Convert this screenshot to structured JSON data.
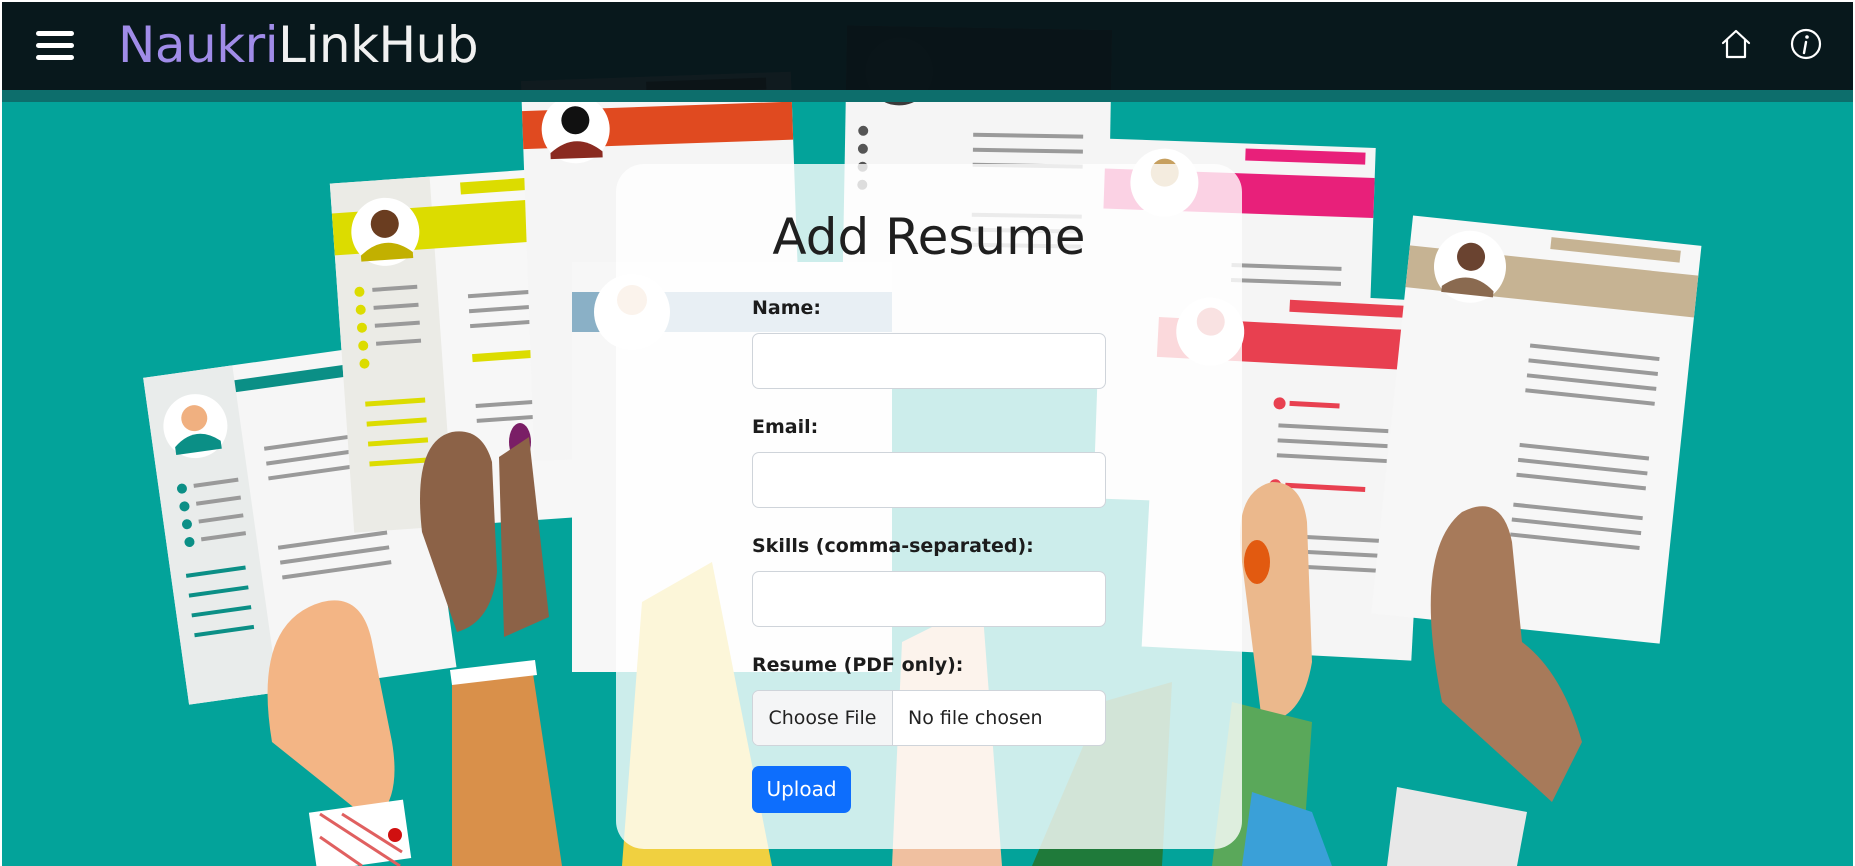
{
  "navbar": {
    "brand_part1": "Naukri",
    "brand_part2": "LinkHub",
    "menu_icon": "hamburger-menu-icon",
    "home_icon": "home-icon",
    "info_icon": "info-icon"
  },
  "form": {
    "title": "Add Resume",
    "name_label": "Name:",
    "email_label": "Email:",
    "skills_label": "Skills (comma-separated):",
    "resume_label": "Resume (PDF only):",
    "file_button": "Choose File",
    "file_status": "No file chosen",
    "upload_button": "Upload"
  },
  "colors": {
    "background": "#03a39a",
    "navbar": "#081418",
    "brand_accent": "#a08ce8",
    "button_primary": "#0d6efd"
  }
}
